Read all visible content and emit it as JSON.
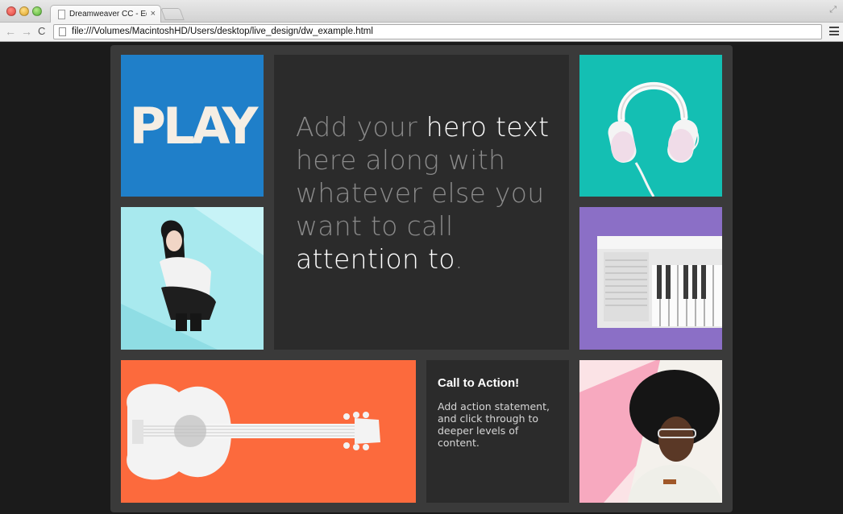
{
  "browser": {
    "tab_title": "Dreamweaver CC - Editable",
    "tab_close": "×",
    "url": "file:///Volumes/MacintoshHD/Users/desktop/live_design/dw_example.html"
  },
  "tiles": {
    "play_text": "PLAY",
    "hero": {
      "part1": "Add your ",
      "part2": "hero text",
      "part3": " here along with whatever else you want to call ",
      "part4": "attention to",
      "part5": "."
    },
    "cta": {
      "title": "Call to Action!",
      "body": "Add action statement, and click through to deeper levels of content."
    }
  },
  "colors": {
    "play_bg": "#1f7fc9",
    "headphones_bg": "#14bfb3",
    "woman_bg": "#a8e9ee",
    "keyboard_bg": "#8b6fc6",
    "guitar_bg": "#fc6a3d",
    "man_bg": "#fbe3e6",
    "tile_dark": "#2b2b2b"
  },
  "icons": [
    "close-icon",
    "new-tab-icon",
    "fullscreen-icon",
    "back-arrow-icon",
    "forward-arrow-icon",
    "reload-icon",
    "page-icon",
    "menu-icon"
  ]
}
